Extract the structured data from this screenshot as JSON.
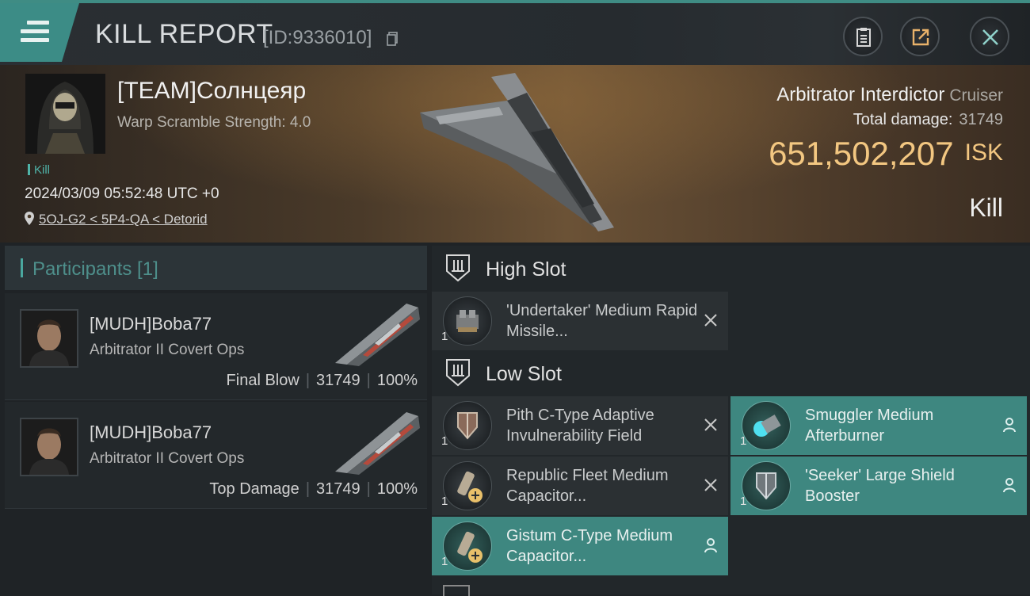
{
  "header": {
    "title": "KILL REPORT",
    "report_id": "[ID:9336010]"
  },
  "victim": {
    "pilot": "[TEAM]Солнцеяр",
    "warp_scramble": "Warp Scramble Strength: 4.0",
    "tag": "Kill",
    "datetime": "2024/03/09 05:52:48 UTC +0",
    "location": "5OJ-G2 < 5P4-QA < Detorid",
    "ship": "Arbitrator Interdictor",
    "ship_class": "Cruiser",
    "damage_label": "Total damage:",
    "damage_value": "31749",
    "isk_value": "651,502,207",
    "isk_unit": "ISK",
    "result": "Kill"
  },
  "participants": {
    "title": "Participants [1]",
    "rows": [
      {
        "name": "[MUDH]Boba77",
        "ship": "Arbitrator II Covert Ops",
        "role": "Final Blow",
        "damage": "31749",
        "percent": "100%"
      },
      {
        "name": "[MUDH]Boba77",
        "ship": "Arbitrator II Covert Ops",
        "role": "Top Damage",
        "damage": "31749",
        "percent": "100%"
      }
    ]
  },
  "slots": {
    "high_label": "High Slot",
    "low_label": "Low Slot",
    "high": [
      {
        "name": "'Undertaker' Medium Rapid Missile...",
        "qty": "1",
        "state": "destroyed"
      }
    ],
    "low": [
      {
        "name": "Pith C-Type Adaptive Invulnerability Field",
        "qty": "1",
        "state": "destroyed"
      },
      {
        "name": "Smuggler Medium Afterburner",
        "qty": "1",
        "state": "dropped"
      },
      {
        "name": "Republic Fleet Medium Capacitor...",
        "qty": "1",
        "state": "destroyed"
      },
      {
        "name": "'Seeker' Large Shield Booster",
        "qty": "1",
        "state": "dropped"
      },
      {
        "name": "Gistum C-Type Medium Capacitor...",
        "qty": "1",
        "state": "dropped"
      }
    ]
  },
  "colors": {
    "accent": "#3e8780",
    "isk": "#f3c781",
    "kill": "#4fb3a8"
  }
}
